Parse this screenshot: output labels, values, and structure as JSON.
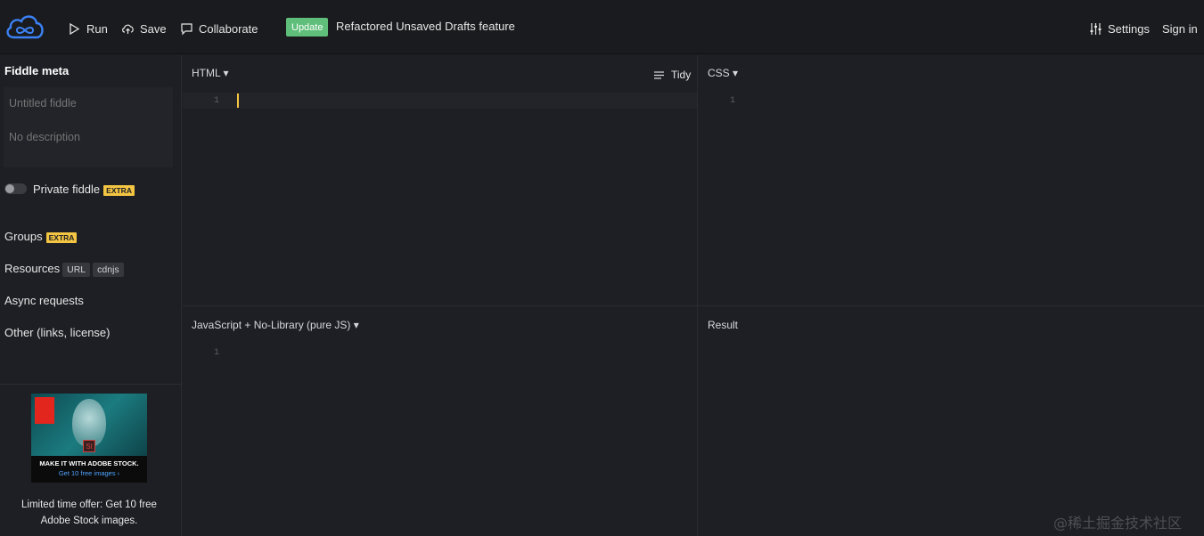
{
  "toolbar": {
    "run_label": "Run",
    "save_label": "Save",
    "collaborate_label": "Collaborate",
    "update_badge": "Update",
    "update_text": "Refactored Unsaved Drafts feature",
    "settings_label": "Settings",
    "signin_label": "Sign in"
  },
  "sidebar": {
    "meta_title": "Fiddle meta",
    "title_placeholder": "Untitled fiddle",
    "description_placeholder": "No description",
    "private_label": "Private fiddle",
    "extra_badge": "EXTRA",
    "groups_label": "Groups",
    "resources_label": "Resources",
    "resources_tags": [
      "URL",
      "cdnjs"
    ],
    "async_label": "Async requests",
    "other_label": "Other (links, license)",
    "ad": {
      "brand": "Adobe",
      "headline": "MAKE IT WITH ADOBE STOCK.",
      "cta": "Get 10 free images ›",
      "caption": "Limited time offer: Get 10 free Adobe Stock images."
    }
  },
  "panes": {
    "html_title": "HTML ▾",
    "tidy_label": "Tidy",
    "css_title": "CSS ▾",
    "js_title": "JavaScript + No-Library (pure JS) ▾",
    "result_title": "Result",
    "line_number": "1"
  },
  "watermark": "@稀土掘金技术社区",
  "colors": {
    "background": "#1d1f24",
    "topbar": "#1a1b1e",
    "update_badge": "#5fbf7a",
    "extra_badge": "#f4c542",
    "logo": "#3b82f6",
    "cursor": "#f4c542"
  },
  "icons": [
    "cloud-infinity-logo",
    "play-icon",
    "upload-cloud-icon",
    "chat-bubble-icon",
    "sliders-icon",
    "align-lines-icon"
  ]
}
